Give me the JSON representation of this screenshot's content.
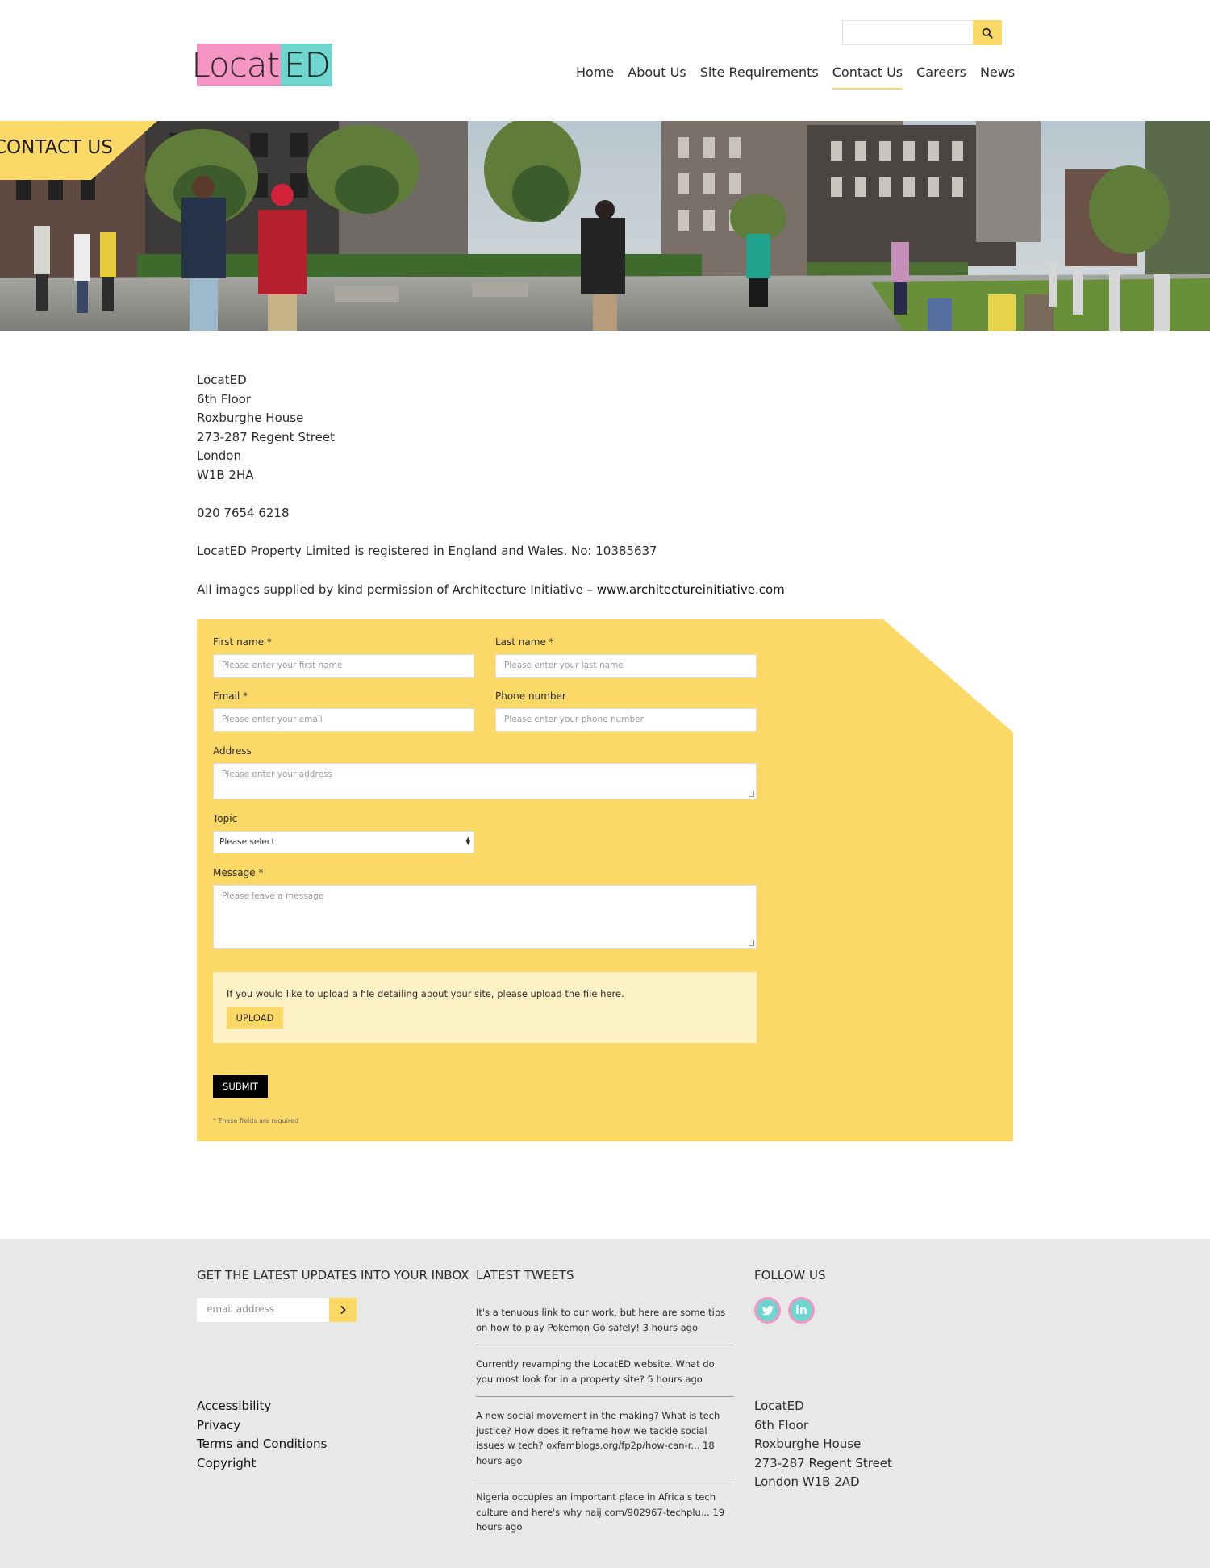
{
  "header": {
    "logo": {
      "left": "Locat",
      "right": "ED"
    },
    "search": {
      "placeholder": "",
      "icon": "search-icon"
    },
    "nav": [
      {
        "label": "Home",
        "active": false
      },
      {
        "label": "About Us",
        "active": false
      },
      {
        "label": "Site Requirements",
        "active": false
      },
      {
        "label": "Contact Us",
        "active": true
      },
      {
        "label": "Careers",
        "active": false
      },
      {
        "label": "News",
        "active": false
      }
    ]
  },
  "hero": {
    "tag": "CONTACT US"
  },
  "address": {
    "lines": [
      "LocatED",
      "6th Floor",
      "Roxburghe House",
      "273-287 Regent Street",
      "London",
      "W1B 2HA"
    ],
    "phone": "020 7654 6218",
    "registration": "LocatED Property Limited is registered in England and Wales. No: 10385637",
    "images_prefix": "All images supplied by kind permission of Architecture Initiative – ",
    "images_link": "www.architectureinitiative.com"
  },
  "form": {
    "first_name": {
      "label": "First name *",
      "placeholder": "Please enter your first name"
    },
    "last_name": {
      "label": "Last name *",
      "placeholder": "Please enter your last name"
    },
    "email": {
      "label": "Email *",
      "placeholder": "Please enter your email"
    },
    "phone": {
      "label": "Phone number",
      "placeholder": "Please enter your phone number"
    },
    "address": {
      "label": "Address",
      "placeholder": "Please enter your address"
    },
    "topic": {
      "label": "Topic",
      "value": "Please select"
    },
    "message": {
      "label": "Message *",
      "placeholder": "Please leave a message"
    },
    "upload_text": "If you would like to upload a file detailing about your site, please upload the file here.",
    "upload_button": "UPLOAD",
    "submit_button": "SUBMIT",
    "required_note": "* These fields are required"
  },
  "footer": {
    "newsletter": {
      "heading": "GET THE LATEST UPDATES INTO YOUR INBOX",
      "placeholder": "email address"
    },
    "tweets": {
      "heading": "LATEST TWEETS",
      "items": [
        "It's a tenuous link to our work, but here are some tips on how to play Pokemon Go safely! 3 hours ago",
        "Currently revamping the LocatED website. What do you most look for in a property site? 5 hours ago",
        "A new social movement in the making? What is tech justice? How does it reframe how we tackle social issues w tech? oxfamblogs.org/fp2p/how-can-r... 18 hours ago",
        "Nigeria occupies an important place in Africa's tech culture and here's why naij.com/902967-techplu... 19 hours ago"
      ]
    },
    "follow": {
      "heading": "FOLLOW US",
      "icons": [
        "twitter-icon",
        "linkedin-icon"
      ]
    },
    "links": [
      "Accessibility",
      "Privacy",
      "Terms and Conditions",
      "Copyright"
    ],
    "address": [
      "LocatED",
      "6th Floor",
      "Roxburghe House",
      "273-287 Regent Street",
      "London W1B 2AD"
    ]
  },
  "colors": {
    "accent": "#fcd966",
    "logo_pink": "#f495c4",
    "logo_teal": "#6fd6cf",
    "footer_bg": "#e8e8e8"
  }
}
